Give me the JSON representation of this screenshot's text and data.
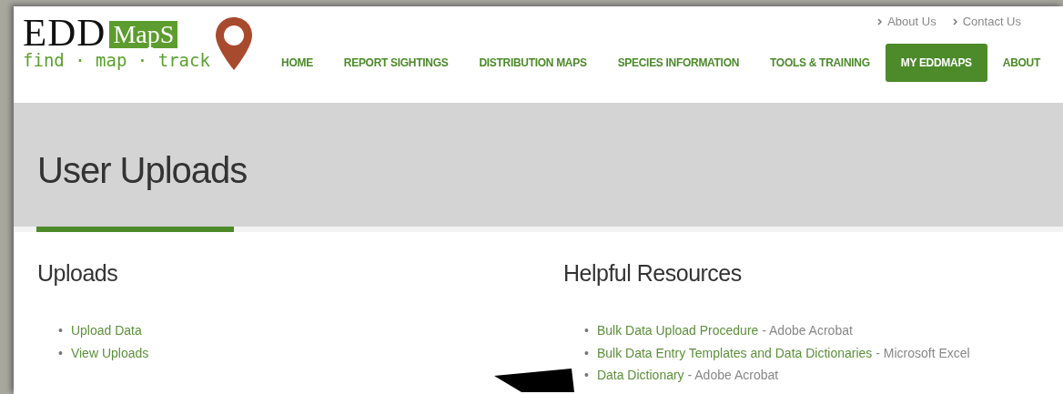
{
  "logo": {
    "word": "EDD",
    "badge": "MapS",
    "tagline": "find · map · track"
  },
  "top_links": [
    "About Us",
    "Contact Us"
  ],
  "nav": [
    {
      "label": "HOME",
      "selected": false
    },
    {
      "label": "REPORT SIGHTINGS",
      "selected": false
    },
    {
      "label": "DISTRIBUTION MAPS",
      "selected": false
    },
    {
      "label": "SPECIES INFORMATION",
      "selected": false
    },
    {
      "label": "TOOLS & TRAINING",
      "selected": false
    },
    {
      "label": "MY EDDMAPS",
      "selected": true
    },
    {
      "label": "ABOUT",
      "selected": false
    }
  ],
  "page_title": "User Uploads",
  "sections": [
    {
      "heading": "Uploads",
      "items": [
        {
          "bullet": "•",
          "link": "Upload Data"
        },
        {
          "bullet": "•",
          "link": "View Uploads"
        }
      ]
    },
    {
      "heading": "Helpful Resources",
      "items": [
        {
          "bullet": "•",
          "link": "Bulk Data Upload Procedure",
          "note": " - Adobe Acrobat"
        },
        {
          "bullet": "•",
          "link": "Bulk Data Entry Templates and Data Dictionaries",
          "note": " - Microsoft Excel"
        },
        {
          "bullet": "•",
          "link": "Data Dictionary",
          "note": " - Adobe Acrobat"
        }
      ]
    }
  ]
}
